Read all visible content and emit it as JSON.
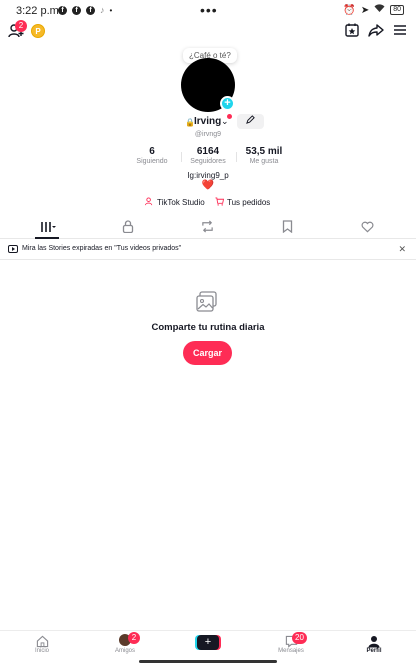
{
  "status_bar": {
    "time": "3:22 p.m.",
    "center_dots": "•••",
    "battery": "80"
  },
  "top_bar": {
    "add_friends_badge": "2",
    "coin_letter": "P"
  },
  "profile": {
    "note_bubble": "¿Café o té?",
    "username": "Irving",
    "handle": "@irvng9",
    "stats": [
      {
        "value": "6",
        "label": "Siguiendo"
      },
      {
        "value": "6164",
        "label": "Seguidores"
      },
      {
        "value": "53,5 mil",
        "label": "Me gusta"
      }
    ],
    "bio": "Ig:irving9_p",
    "heart": "❤️",
    "links": [
      {
        "label": "TikTok Studio"
      },
      {
        "label": "Tus pedidos"
      }
    ]
  },
  "banner": {
    "text": "Mira las Stories expiradas en \"Tus videos privados\""
  },
  "empty_state": {
    "title": "Comparte tu rutina diaria",
    "button": "Cargar"
  },
  "bottom_nav": {
    "items": [
      {
        "label": "Inicio"
      },
      {
        "label": "Amigos",
        "badge": "2"
      },
      {
        "label": ""
      },
      {
        "label": "Mensajes",
        "badge": "20"
      },
      {
        "label": "Perfil"
      }
    ]
  },
  "colors": {
    "accent": "#fe2c55",
    "cyan": "#20d5ec",
    "text": "#161823"
  }
}
